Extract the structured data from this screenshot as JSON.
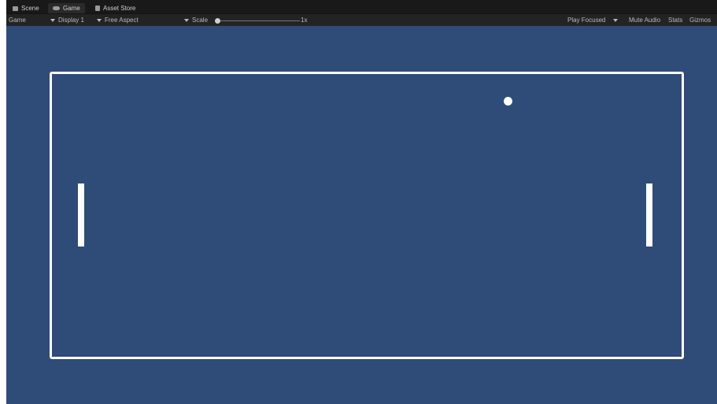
{
  "tabs": [
    {
      "label": "Scene",
      "icon": "scene-icon"
    },
    {
      "label": "Game",
      "icon": "gamepad-icon",
      "active": true
    },
    {
      "label": "Asset Store",
      "icon": "store-icon"
    }
  ],
  "toolbar": {
    "view_label": "Game",
    "display": "Display 1",
    "aspect": "Free Aspect",
    "scale_label": "Scale",
    "scale_value": "1x",
    "play_mode": "Play Focused",
    "mute_audio": "Mute Audio",
    "stats": "Stats",
    "gizmos": "Gizmos"
  },
  "colors": {
    "game_background": "#2f4c78",
    "court_line": "#ffffff",
    "toolbar_bg": "#232323"
  }
}
